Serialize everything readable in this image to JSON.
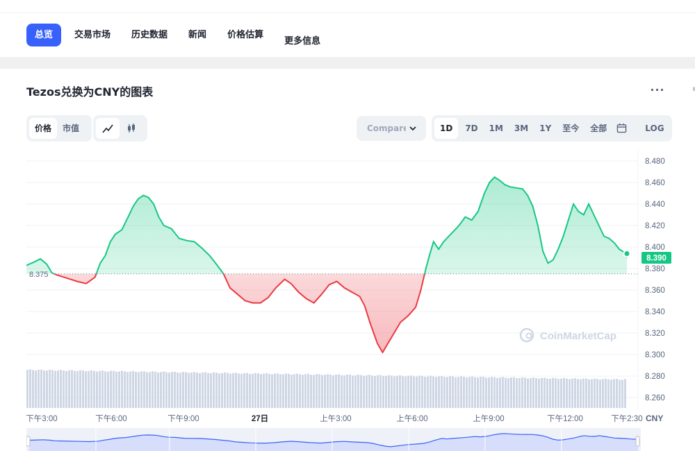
{
  "nav": {
    "tabs": [
      {
        "label": "总览",
        "active": true
      },
      {
        "label": "交易市场"
      },
      {
        "label": "历史数据"
      },
      {
        "label": "新闻"
      },
      {
        "label": "价格估算"
      },
      {
        "label": "更多信息"
      }
    ]
  },
  "chart_header": {
    "title": "Tezos兑换为CNY的图表",
    "more": "···"
  },
  "toolbar": {
    "metric_tabs": [
      {
        "label": "价格",
        "active": true
      },
      {
        "label": "市值"
      }
    ],
    "type_icons": [
      "line-chart-icon",
      "candlestick-icon"
    ],
    "compare_label": "Compare with",
    "ranges": [
      {
        "label": "1D",
        "active": true
      },
      {
        "label": "7D"
      },
      {
        "label": "1M"
      },
      {
        "label": "3M"
      },
      {
        "label": "1Y"
      },
      {
        "label": "至今"
      },
      {
        "label": "全部"
      }
    ],
    "calendar_icon": "calendar-icon",
    "log_label": "LOG"
  },
  "colors": {
    "up": "#16c784",
    "down": "#ea3943",
    "brand": "#3861fb",
    "volume": "#cfd6e4"
  },
  "chart_data": {
    "type": "area",
    "baseline": 8.375,
    "baseline_label": "8.375",
    "current_value": 8.39,
    "current_label": "8.390",
    "y_ticks": [
      "8.480",
      "8.460",
      "8.440",
      "8.420",
      "8.400",
      "8.380",
      "8.360",
      "8.340",
      "8.320",
      "8.300",
      "8.280",
      "8.260"
    ],
    "x_ticks": [
      "下午3:00",
      "下午6:00",
      "下午9:00",
      "27日",
      "上午3:00",
      "上午6:00",
      "上午9:00",
      "下午12:00",
      "下午2:30"
    ],
    "currency": "CNY",
    "watermark": "CoinMarketCap",
    "ylim": [
      8.25,
      8.49
    ],
    "x_range": [
      0,
      23.6
    ],
    "price": [
      [
        0,
        8.383
      ],
      [
        0.3,
        8.386
      ],
      [
        0.55,
        8.389
      ],
      [
        0.8,
        8.384
      ],
      [
        1,
        8.376
      ],
      [
        1.2,
        8.374
      ],
      [
        1.6,
        8.371
      ],
      [
        2,
        8.368
      ],
      [
        2.35,
        8.366
      ],
      [
        2.7,
        8.372
      ],
      [
        2.9,
        8.385
      ],
      [
        3.1,
        8.392
      ],
      [
        3.3,
        8.405
      ],
      [
        3.5,
        8.412
      ],
      [
        3.75,
        8.416
      ],
      [
        4,
        8.428
      ],
      [
        4.2,
        8.438
      ],
      [
        4.4,
        8.445
      ],
      [
        4.6,
        8.448
      ],
      [
        4.8,
        8.446
      ],
      [
        5,
        8.44
      ],
      [
        5.2,
        8.428
      ],
      [
        5.4,
        8.42
      ],
      [
        5.7,
        8.417
      ],
      [
        6,
        8.408
      ],
      [
        6.3,
        8.406
      ],
      [
        6.6,
        8.405
      ],
      [
        6.9,
        8.399
      ],
      [
        7.2,
        8.392
      ],
      [
        7.5,
        8.383
      ],
      [
        7.75,
        8.375
      ],
      [
        8,
        8.362
      ],
      [
        8.3,
        8.356
      ],
      [
        8.6,
        8.35
      ],
      [
        8.9,
        8.348
      ],
      [
        9.2,
        8.348
      ],
      [
        9.5,
        8.353
      ],
      [
        9.8,
        8.362
      ],
      [
        10.15,
        8.37
      ],
      [
        10.4,
        8.366
      ],
      [
        10.7,
        8.358
      ],
      [
        11,
        8.352
      ],
      [
        11.3,
        8.348
      ],
      [
        11.6,
        8.356
      ],
      [
        11.9,
        8.365
      ],
      [
        12.2,
        8.368
      ],
      [
        12.5,
        8.362
      ],
      [
        12.8,
        8.358
      ],
      [
        13.1,
        8.354
      ],
      [
        13.3,
        8.345
      ],
      [
        13.5,
        8.33
      ],
      [
        13.8,
        8.31
      ],
      [
        14,
        8.302
      ],
      [
        14.2,
        8.31
      ],
      [
        14.45,
        8.32
      ],
      [
        14.7,
        8.33
      ],
      [
        15,
        8.336
      ],
      [
        15.3,
        8.344
      ],
      [
        15.5,
        8.36
      ],
      [
        15.7,
        8.38
      ],
      [
        15.85,
        8.393
      ],
      [
        16,
        8.405
      ],
      [
        16.2,
        8.398
      ],
      [
        16.4,
        8.405
      ],
      [
        16.6,
        8.41
      ],
      [
        16.8,
        8.415
      ],
      [
        17,
        8.42
      ],
      [
        17.25,
        8.428
      ],
      [
        17.5,
        8.425
      ],
      [
        17.75,
        8.433
      ],
      [
        18,
        8.45
      ],
      [
        18.2,
        8.46
      ],
      [
        18.4,
        8.465
      ],
      [
        18.6,
        8.462
      ],
      [
        18.8,
        8.458
      ],
      [
        19,
        8.456
      ],
      [
        19.25,
        8.455
      ],
      [
        19.5,
        8.454
      ],
      [
        19.7,
        8.448
      ],
      [
        19.9,
        8.438
      ],
      [
        20.1,
        8.42
      ],
      [
        20.3,
        8.396
      ],
      [
        20.5,
        8.385
      ],
      [
        20.7,
        8.388
      ],
      [
        20.9,
        8.398
      ],
      [
        21.1,
        8.41
      ],
      [
        21.3,
        8.425
      ],
      [
        21.5,
        8.44
      ],
      [
        21.7,
        8.433
      ],
      [
        21.9,
        8.43
      ],
      [
        22.1,
        8.44
      ],
      [
        22.3,
        8.43
      ],
      [
        22.5,
        8.42
      ],
      [
        22.7,
        8.41
      ],
      [
        22.9,
        8.408
      ],
      [
        23.1,
        8.404
      ],
      [
        23.3,
        8.398
      ],
      [
        23.5,
        8.395
      ],
      [
        23.6,
        8.39
      ]
    ],
    "series": [
      {
        "values_ref": "price"
      }
    ]
  }
}
